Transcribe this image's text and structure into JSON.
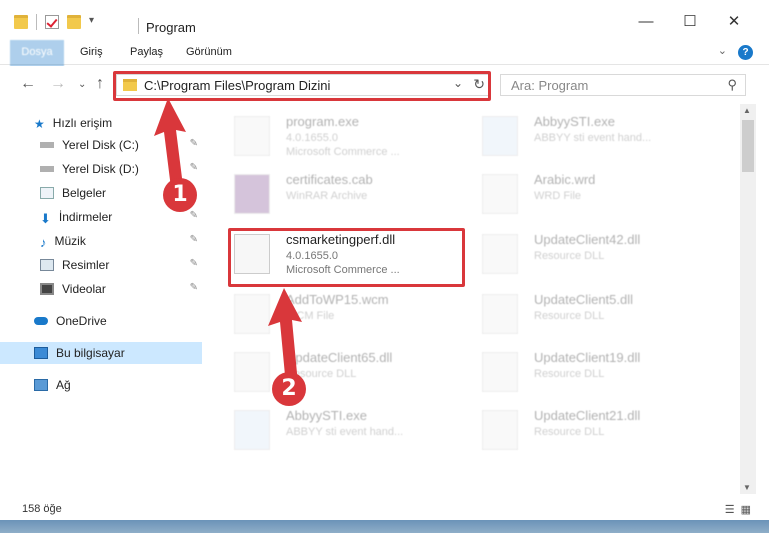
{
  "titlebar": {
    "title": "Program",
    "minimize": "—",
    "maximize": "☐",
    "close": "✕"
  },
  "ribbon": {
    "tabs": [
      "Dosya",
      "Giriş",
      "Paylaş",
      "Görünüm"
    ],
    "help": "?"
  },
  "nav": {
    "back": "←",
    "forward": "→",
    "up": "↑",
    "address": "C:\\Program Files\\Program Dizini",
    "search_placeholder": "Ara: Program"
  },
  "sidebar": {
    "items": [
      {
        "label": "Hızlı erişim",
        "icon": "star-icon"
      },
      {
        "label": "Yerel Disk (C:)",
        "icon": "drive-icon"
      },
      {
        "label": "Yerel Disk (D:)",
        "icon": "drive-icon"
      },
      {
        "label": "Belgeler",
        "icon": "documents-icon"
      },
      {
        "label": "İndirmeler",
        "icon": "download-icon"
      },
      {
        "label": "Müzik",
        "icon": "music-icon"
      },
      {
        "label": "Resimler",
        "icon": "pictures-icon"
      },
      {
        "label": "Videolar",
        "icon": "videos-icon"
      },
      {
        "label": "OneDrive",
        "icon": "cloud-icon"
      },
      {
        "label": "Bu bilgisayar",
        "icon": "computer-icon"
      },
      {
        "label": "Ağ",
        "icon": "network-icon"
      }
    ]
  },
  "files": {
    "left": [
      {
        "name": "program.exe",
        "line1": "4.0.1655.0",
        "line2": "Microsoft Commerce ..."
      },
      {
        "name": "certificates.cab",
        "line1": "WinRAR Archive",
        "line2": ""
      },
      {
        "name": "csmarketingperf.dll",
        "line1": "4.0.1655.0",
        "line2": "Microsoft Commerce ..."
      },
      {
        "name": "AddToWP15.wcm",
        "line1": "WCM File",
        "line2": ""
      },
      {
        "name": "UpdateClient65.dll",
        "line1": "Resource DLL",
        "line2": ""
      },
      {
        "name": "AbbyySTI.exe",
        "line1": "ABBYY sti event hand...",
        "line2": ""
      }
    ],
    "right": [
      {
        "name": "AbbyySTI.exe",
        "line1": "ABBYY sti event hand...",
        "line2": ""
      },
      {
        "name": "Arabic.wrd",
        "line1": "WRD File",
        "line2": ""
      },
      {
        "name": "UpdateClient42.dll",
        "line1": "Resource DLL",
        "line2": ""
      },
      {
        "name": "UpdateClient5.dll",
        "line1": "Resource DLL",
        "line2": ""
      },
      {
        "name": "UpdateClient19.dll",
        "line1": "Resource DLL",
        "line2": ""
      },
      {
        "name": "UpdateClient21.dll",
        "line1": "Resource DLL",
        "line2": ""
      }
    ]
  },
  "status": {
    "count": "158 öğe"
  },
  "annotations": {
    "step1": "1",
    "step2": "2"
  },
  "colors": {
    "accent": "#1979ca",
    "highlight": "#d9373b",
    "selected": "#cce8ff"
  }
}
